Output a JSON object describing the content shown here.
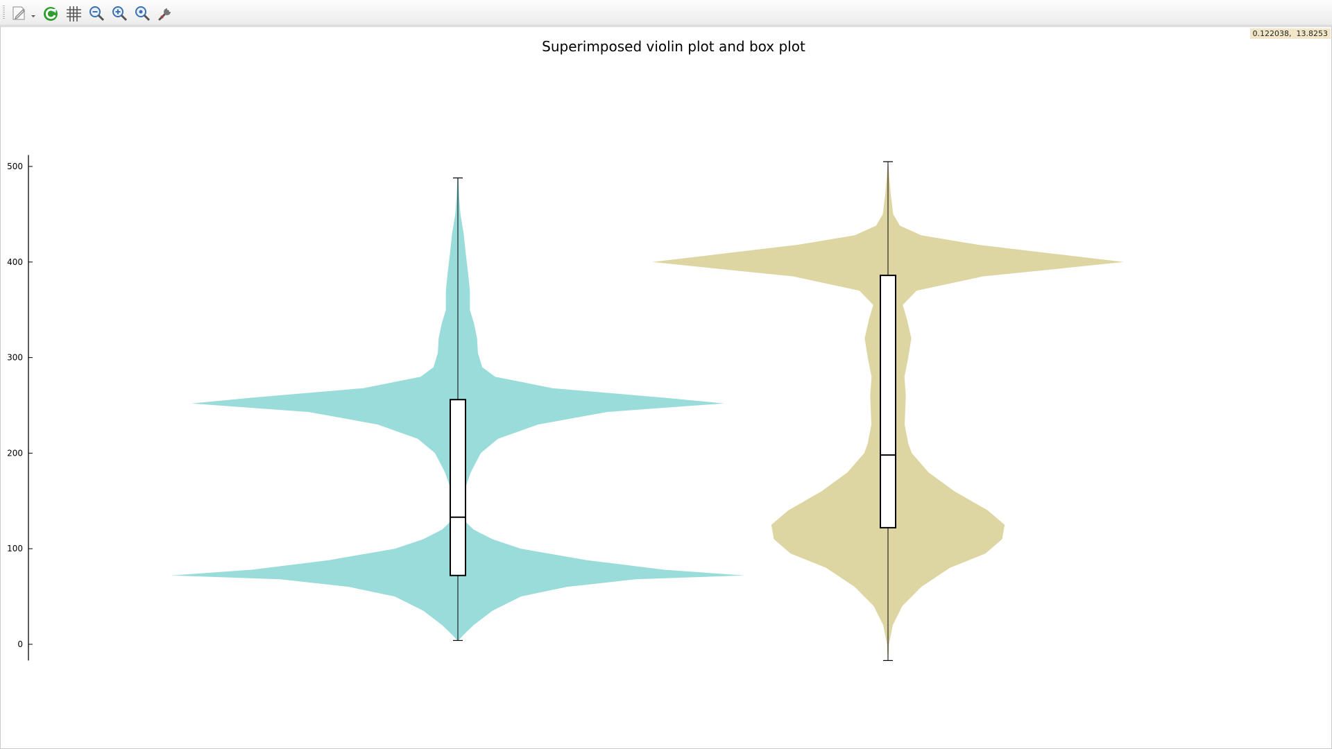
{
  "toolbar": {
    "buttons": [
      {
        "name": "export-plot-button",
        "icon": "export-icon"
      },
      {
        "name": "replot-button",
        "icon": "refresh-icon"
      },
      {
        "name": "toggle-grid-button",
        "icon": "grid-icon"
      },
      {
        "name": "previous-zoom-button",
        "icon": "zoom-out-icon"
      },
      {
        "name": "next-zoom-button",
        "icon": "zoom-in-icon"
      },
      {
        "name": "autoscale-button",
        "icon": "zoom-fit-icon"
      },
      {
        "name": "settings-button",
        "icon": "wrench-icon"
      }
    ]
  },
  "status": {
    "mouse_coordinates": "0.122038,  13.8253"
  },
  "chart_data": {
    "type": "violin",
    "title": "Superimposed violin plot and box plot",
    "xlabel": "",
    "ylabel": "",
    "ylim": [
      -17,
      512
    ],
    "yticks": [
      0,
      100,
      200,
      300,
      400,
      500
    ],
    "grid": false,
    "legend": "none",
    "series": [
      {
        "color": "#9adcda",
        "box": {
          "min": 4,
          "q1": 72,
          "median": 133,
          "q3": 256,
          "max": 488
        },
        "density": [
          [
            4,
            0.002
          ],
          [
            10,
            0.02
          ],
          [
            20,
            0.055
          ],
          [
            35,
            0.12
          ],
          [
            50,
            0.22
          ],
          [
            60,
            0.38
          ],
          [
            68,
            0.62
          ],
          [
            72,
            1.0
          ],
          [
            78,
            0.72
          ],
          [
            88,
            0.45
          ],
          [
            100,
            0.22
          ],
          [
            110,
            0.12
          ],
          [
            120,
            0.055
          ],
          [
            130,
            0.02
          ],
          [
            140,
            0.015
          ],
          [
            160,
            0.022
          ],
          [
            180,
            0.045
          ],
          [
            200,
            0.08
          ],
          [
            215,
            0.14
          ],
          [
            230,
            0.28
          ],
          [
            243,
            0.52
          ],
          [
            252,
            0.93
          ],
          [
            258,
            0.72
          ],
          [
            268,
            0.33
          ],
          [
            280,
            0.13
          ],
          [
            290,
            0.085
          ],
          [
            305,
            0.07
          ],
          [
            320,
            0.067
          ],
          [
            335,
            0.057
          ],
          [
            350,
            0.042
          ],
          [
            370,
            0.042
          ],
          [
            390,
            0.035
          ],
          [
            410,
            0.027
          ],
          [
            430,
            0.02
          ],
          [
            450,
            0.009
          ],
          [
            470,
            0.004
          ],
          [
            488,
            0.002
          ]
        ]
      },
      {
        "color": "#ddd6a3",
        "box": {
          "min": -17,
          "q1": 122,
          "median": 198,
          "q3": 386,
          "max": 505
        },
        "density": [
          [
            -17,
            0.001
          ],
          [
            0,
            0.004
          ],
          [
            20,
            0.02
          ],
          [
            40,
            0.06
          ],
          [
            60,
            0.14
          ],
          [
            80,
            0.26
          ],
          [
            95,
            0.41
          ],
          [
            110,
            0.48
          ],
          [
            125,
            0.49
          ],
          [
            140,
            0.42
          ],
          [
            160,
            0.28
          ],
          [
            180,
            0.17
          ],
          [
            200,
            0.1
          ],
          [
            210,
            0.085
          ],
          [
            230,
            0.07
          ],
          [
            260,
            0.075
          ],
          [
            280,
            0.069
          ],
          [
            300,
            0.085
          ],
          [
            320,
            0.098
          ],
          [
            340,
            0.08
          ],
          [
            355,
            0.062
          ],
          [
            370,
            0.12
          ],
          [
            385,
            0.4
          ],
          [
            393,
            0.72
          ],
          [
            400,
            0.99
          ],
          [
            408,
            0.72
          ],
          [
            418,
            0.38
          ],
          [
            428,
            0.14
          ],
          [
            438,
            0.05
          ],
          [
            450,
            0.022
          ],
          [
            470,
            0.012
          ],
          [
            490,
            0.005
          ],
          [
            505,
            0.001
          ]
        ]
      }
    ]
  }
}
